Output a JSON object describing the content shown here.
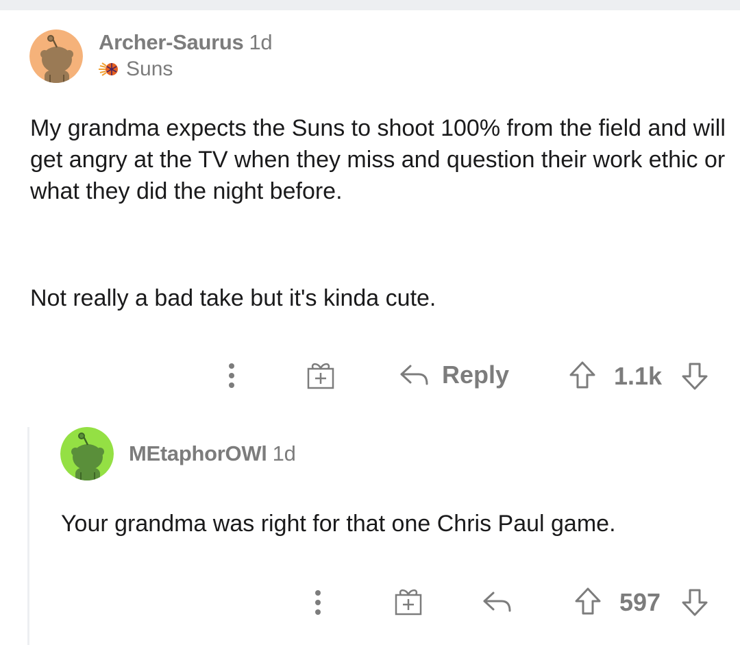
{
  "top_comment": {
    "username": "Archer-Saurus",
    "age": "1d",
    "flair": "Suns",
    "flair_icon": "suns-logo-icon",
    "avatar_color": "#f5b27a",
    "paragraphs": [
      "My grandma expects the Suns to shoot 100% from the field and will get angry at the TV when they miss and question their work ethic or what they did the night before.",
      "Not really a bad take but it's kinda cute."
    ],
    "actions": {
      "more_icon": "more-vertical-icon",
      "award_icon": "gift-award-icon",
      "reply_icon": "reply-arrow-icon",
      "reply_label": "Reply",
      "upvote_icon": "upvote-arrow-icon",
      "score": "1.1k",
      "downvote_icon": "downvote-arrow-icon"
    }
  },
  "reply_comment": {
    "username": "MEtaphorOWl",
    "age": "1d",
    "avatar_color": "#94e044",
    "paragraphs": [
      "Your grandma was right for that one Chris Paul game."
    ],
    "actions": {
      "more_icon": "more-vertical-icon",
      "award_icon": "gift-award-icon",
      "reply_icon": "reply-arrow-icon",
      "upvote_icon": "upvote-arrow-icon",
      "score": "597",
      "downvote_icon": "downvote-arrow-icon"
    }
  },
  "colors": {
    "meta_text": "#7c7c7c",
    "body_text": "#1a1a1b",
    "divider": "#edeff1"
  }
}
